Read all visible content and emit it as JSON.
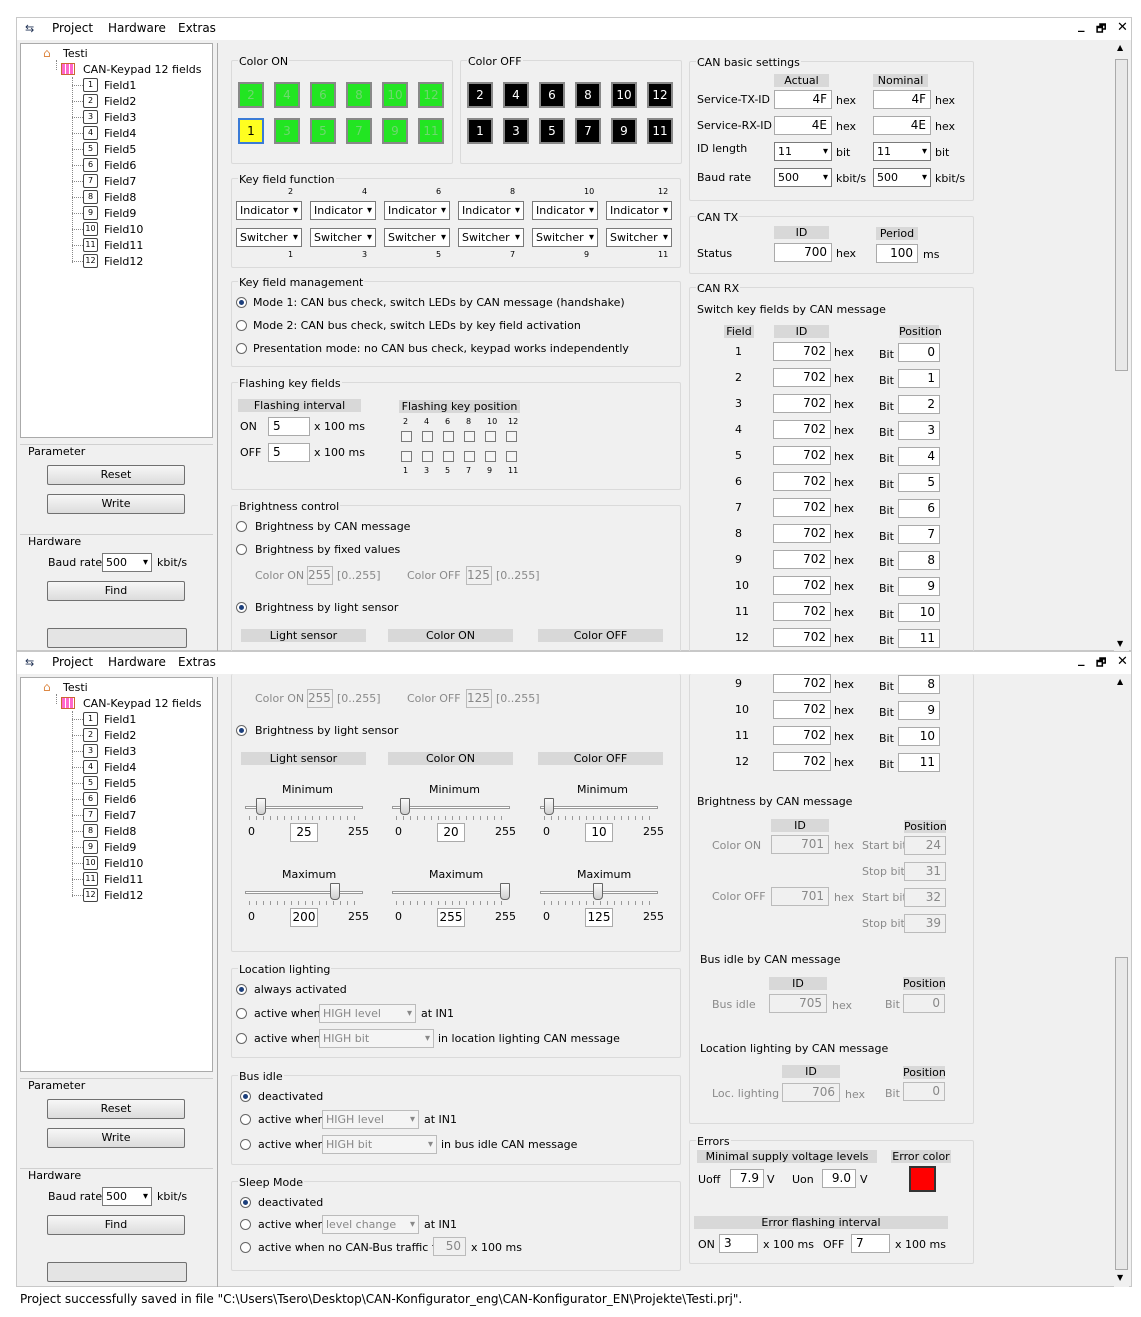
{
  "menu": {
    "project": "Project",
    "hardware": "Hardware",
    "extras": "Extras"
  },
  "window_controls": {
    "minimize": "_",
    "restore": "🗗",
    "close": "✕"
  },
  "tree": {
    "root": "Testi",
    "device": "CAN-Keypad 12 fields",
    "fields": [
      {
        "num": "1",
        "label": "Field1"
      },
      {
        "num": "2",
        "label": "Field2"
      },
      {
        "num": "3",
        "label": "Field3"
      },
      {
        "num": "4",
        "label": "Field4"
      },
      {
        "num": "5",
        "label": "Field5"
      },
      {
        "num": "6",
        "label": "Field6"
      },
      {
        "num": "7",
        "label": "Field7"
      },
      {
        "num": "8",
        "label": "Field8"
      },
      {
        "num": "9",
        "label": "Field9"
      },
      {
        "num": "10",
        "label": "Field10"
      },
      {
        "num": "11",
        "label": "Field11"
      },
      {
        "num": "12",
        "label": "Field12"
      }
    ]
  },
  "left": {
    "parameter": "Parameter",
    "reset": "Reset",
    "write": "Write",
    "hardware": "Hardware",
    "baud_label": "Baud rate",
    "baud_value": "500",
    "baud_unit": "kbit/s",
    "find": "Find"
  },
  "color_on": {
    "title": "Color ON",
    "top": [
      "2",
      "4",
      "6",
      "8",
      "10",
      "12"
    ],
    "bottom": [
      "1",
      "3",
      "5",
      "7",
      "9",
      "11"
    ]
  },
  "color_off": {
    "title": "Color OFF",
    "top": [
      "2",
      "4",
      "6",
      "8",
      "10",
      "12"
    ],
    "bottom": [
      "1",
      "3",
      "5",
      "7",
      "9",
      "11"
    ]
  },
  "key_function": {
    "title": "Key field function",
    "top_nums": [
      "2",
      "4",
      "6",
      "8",
      "10",
      "12"
    ],
    "bottom_nums": [
      "1",
      "3",
      "5",
      "7",
      "9",
      "11"
    ],
    "top_value": "Indicator",
    "bottom_value": "Switcher"
  },
  "key_management": {
    "title": "Key field management",
    "mode1": "Mode 1: CAN bus check, switch LEDs by CAN message (handshake)",
    "mode2": "Mode 2: CAN bus check, switch LEDs by key field activation",
    "mode3": "Presentation mode: no CAN bus check, keypad works independently"
  },
  "flashing": {
    "title": "Flashing key fields",
    "interval": "Flashing interval",
    "position": "Flashing key position",
    "on_label": "ON",
    "on_value": "5",
    "off_label": "OFF",
    "off_value": "5",
    "unit": "x 100 ms",
    "top_nums": [
      "2",
      "4",
      "6",
      "8",
      "10",
      "12"
    ],
    "bottom_nums": [
      "1",
      "3",
      "5",
      "7",
      "9",
      "11"
    ]
  },
  "brightness": {
    "title": "Brightness control",
    "by_can": "Brightness by CAN message",
    "by_fixed": "Brightness by fixed values",
    "color_on": "Color ON",
    "color_on_value": "255",
    "range": "[0..255]",
    "color_off": "Color OFF",
    "color_off_value": "125",
    "by_sensor": "Brightness by light sensor",
    "light_sensor": "Light sensor",
    "col_on": "Color ON",
    "col_off": "Color OFF",
    "minimum": "Minimum",
    "maximum": "Maximum",
    "zero": "0",
    "max": "255",
    "mins": [
      {
        "value": "25",
        "level": 25
      },
      {
        "value": "20",
        "level": 20
      },
      {
        "value": "10",
        "level": 10
      }
    ],
    "maxs": [
      {
        "value": "200",
        "level": 200
      },
      {
        "value": "255",
        "level": 255
      },
      {
        "value": "125",
        "level": 125
      }
    ]
  },
  "location": {
    "title": "Location lighting",
    "always": "always activated",
    "active_when": "active when",
    "high_level": "HIGH level",
    "at_in1": "at IN1",
    "high_bit": "HIGH bit",
    "in_msg": "in location lighting CAN message"
  },
  "bus_idle": {
    "title": "Bus idle",
    "deactivated": "deactivated",
    "active_when": "active when",
    "high_level": "HIGH level",
    "at_in1": "at IN1",
    "high_bit": "HIGH bit",
    "in_msg": "in bus idle CAN message"
  },
  "sleep": {
    "title": "Sleep Mode",
    "deactivated": "deactivated",
    "active_when": "active when",
    "level_change": "level change",
    "at_in1": "at IN1",
    "no_traffic": "active when no CAN-Bus traffic for",
    "traffic_value": "50",
    "unit": "x 100 ms"
  },
  "can_basic": {
    "title": "CAN basic settings",
    "actual": "Actual",
    "nominal": "Nominal",
    "tx_label": "Service-TX-ID",
    "tx_actual": "4F",
    "tx_nominal": "4F",
    "rx_label": "Service-RX-ID",
    "rx_actual": "4E",
    "rx_nominal": "4E",
    "idlen_label": "ID length",
    "idlen_actual": "11",
    "idlen_nominal": "11",
    "bit": "bit",
    "baud_label": "Baud rate",
    "baud_actual": "500",
    "baud_nominal": "500",
    "kbits": "kbit/s",
    "hex": "hex"
  },
  "can_tx": {
    "title": "CAN TX",
    "id": "ID",
    "period": "Period",
    "status": "Status",
    "id_value": "700",
    "period_value": "100",
    "hex": "hex",
    "ms": "ms"
  },
  "can_rx": {
    "title": "CAN RX",
    "subtitle": "Switch key fields by CAN message",
    "field": "Field",
    "id": "ID",
    "position": "Position",
    "hex": "hex",
    "bit": "Bit",
    "rows": [
      {
        "f": "1",
        "id": "702",
        "pos": "0"
      },
      {
        "f": "2",
        "id": "702",
        "pos": "1"
      },
      {
        "f": "3",
        "id": "702",
        "pos": "2"
      },
      {
        "f": "4",
        "id": "702",
        "pos": "3"
      },
      {
        "f": "5",
        "id": "702",
        "pos": "4"
      },
      {
        "f": "6",
        "id": "702",
        "pos": "5"
      },
      {
        "f": "7",
        "id": "702",
        "pos": "6"
      },
      {
        "f": "8",
        "id": "702",
        "pos": "7"
      },
      {
        "f": "9",
        "id": "702",
        "pos": "8"
      },
      {
        "f": "10",
        "id": "702",
        "pos": "9"
      },
      {
        "f": "11",
        "id": "702",
        "pos": "10"
      },
      {
        "f": "12",
        "id": "702",
        "pos": "11"
      }
    ],
    "rows_lower": [
      {
        "f": "9",
        "id": "702",
        "pos": "8"
      },
      {
        "f": "10",
        "id": "702",
        "pos": "9"
      },
      {
        "f": "11",
        "id": "702",
        "pos": "10"
      },
      {
        "f": "12",
        "id": "702",
        "pos": "11"
      }
    ]
  },
  "brightness_can": {
    "title": "Brightness by CAN message",
    "id": "ID",
    "position": "Position",
    "color_on": "Color ON",
    "color_on_id": "701",
    "color_off": "Color OFF",
    "color_off_id": "701",
    "hex": "hex",
    "start_bit": "Start bit",
    "stop_bit": "Stop bit",
    "on_start": "24",
    "on_stop": "31",
    "off_start": "32",
    "off_stop": "39"
  },
  "bus_idle_can": {
    "title": "Bus idle by CAN message",
    "id": "ID",
    "position": "Position",
    "label": "Bus idle",
    "id_value": "705",
    "hex": "hex",
    "bit": "Bit",
    "bit_value": "0"
  },
  "loc_can": {
    "title": "Location lighting by CAN message",
    "id": "ID",
    "position": "Position",
    "label": "Loc. lighting",
    "id_value": "706",
    "hex": "hex",
    "bit": "Bit",
    "bit_value": "0"
  },
  "errors": {
    "title": "Errors",
    "min_supply": "Minimal supply voltage levels",
    "error_color": "Error color",
    "uoff": "Uoff",
    "uoff_value": "7.9",
    "uon": "Uon",
    "uon_value": "9.0",
    "v": "V",
    "flash_interval": "Error flashing interval",
    "on": "ON",
    "on_value": "3",
    "off": "OFF",
    "off_value": "7",
    "unit": "x 100 ms",
    "error_color_hex": "#ff0000"
  },
  "status": "Project successfully saved in file \"C:\\Users\\Tsero\\Desktop\\CAN-Konfigurator_eng\\CAN-Konfigurator_EN\\Projekte\\Testi.prj\"."
}
